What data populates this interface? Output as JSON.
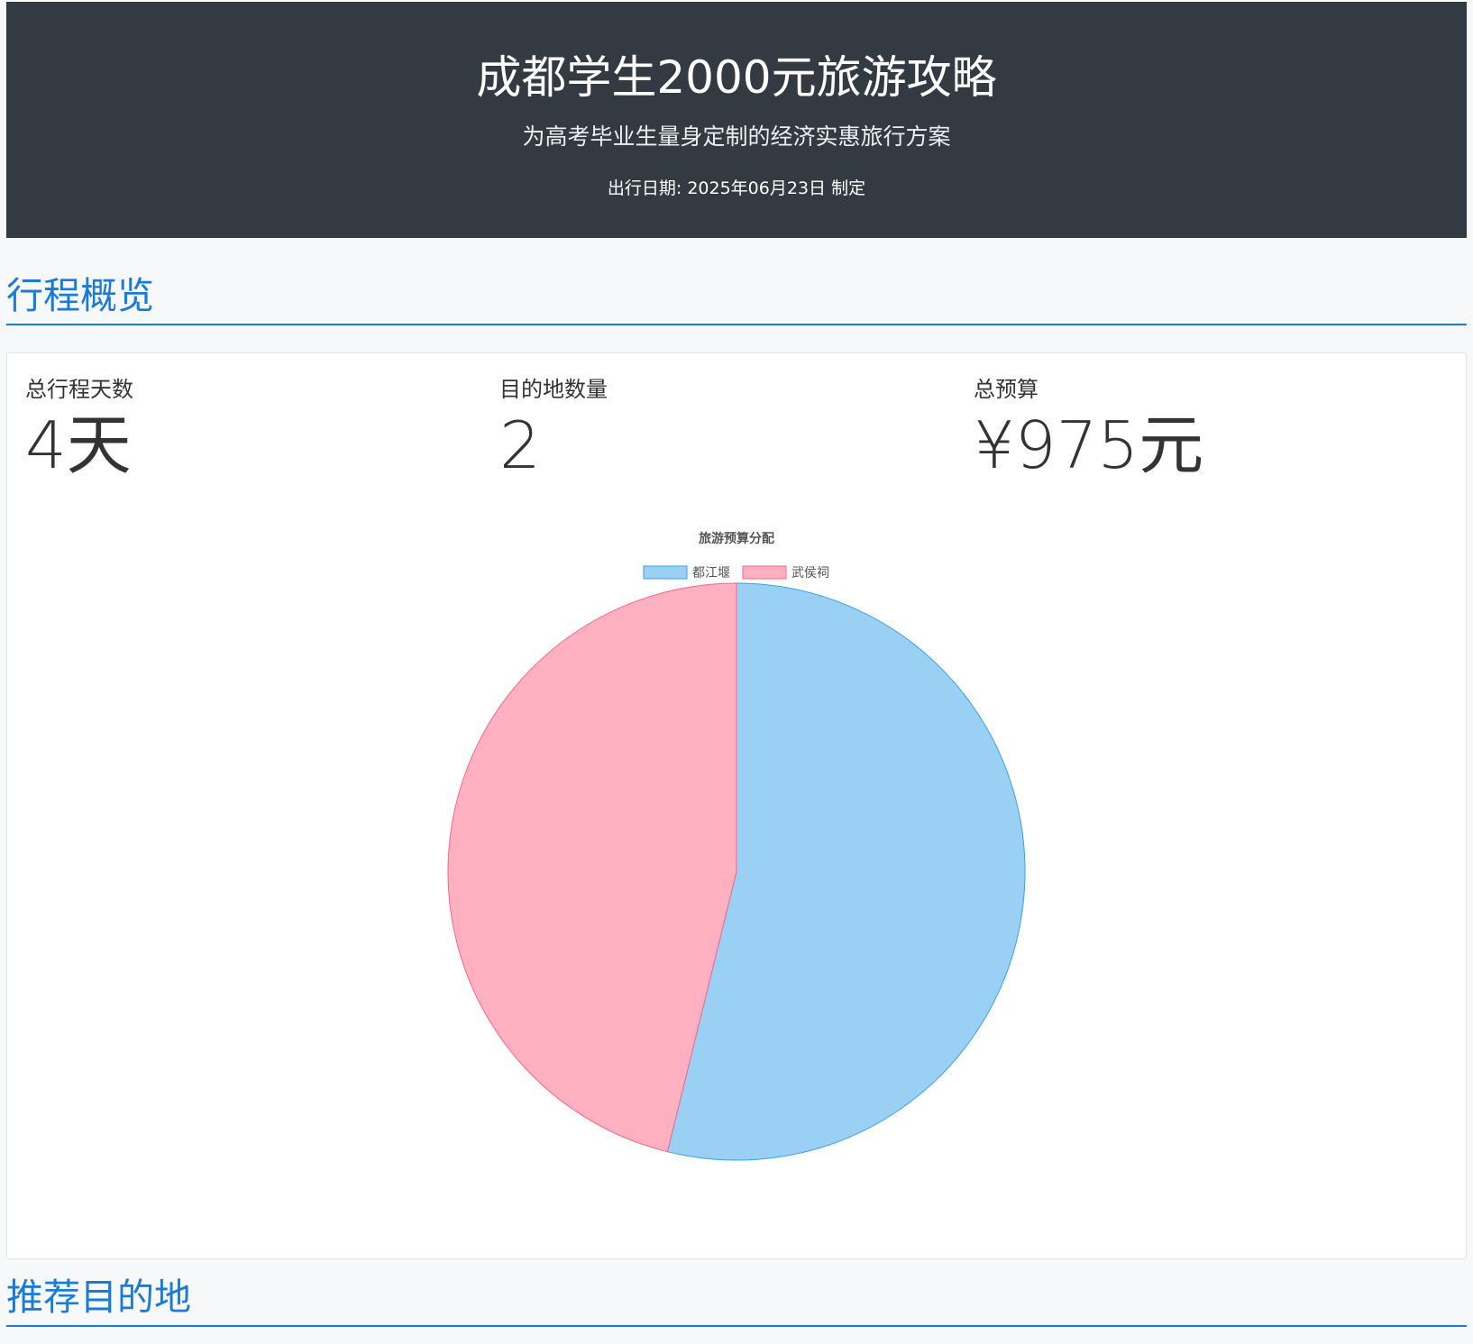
{
  "header": {
    "title": "成都学生2000元旅游攻略",
    "subtitle": "为高考毕业生量身定制的经济实惠旅行方案",
    "date": "出行日期: 2025年06月23日 制定"
  },
  "overview": {
    "section_title": "行程概览",
    "stats": [
      {
        "label": "总行程天数",
        "value": "4天"
      },
      {
        "label": "目的地数量",
        "value": "2"
      },
      {
        "label": "总预算",
        "value": "¥975元"
      }
    ]
  },
  "chart_data": {
    "type": "pie",
    "title": "旅游预算分配",
    "categories": [
      "都江堰",
      "武侯祠"
    ],
    "values": [
      525,
      450
    ],
    "colors": [
      "#9bd0f5",
      "#ffb1c1"
    ],
    "border_colors": [
      "#36a2eb",
      "#ff6384"
    ],
    "legend": "top"
  },
  "destinations": {
    "section_title": "推荐目的地"
  }
}
